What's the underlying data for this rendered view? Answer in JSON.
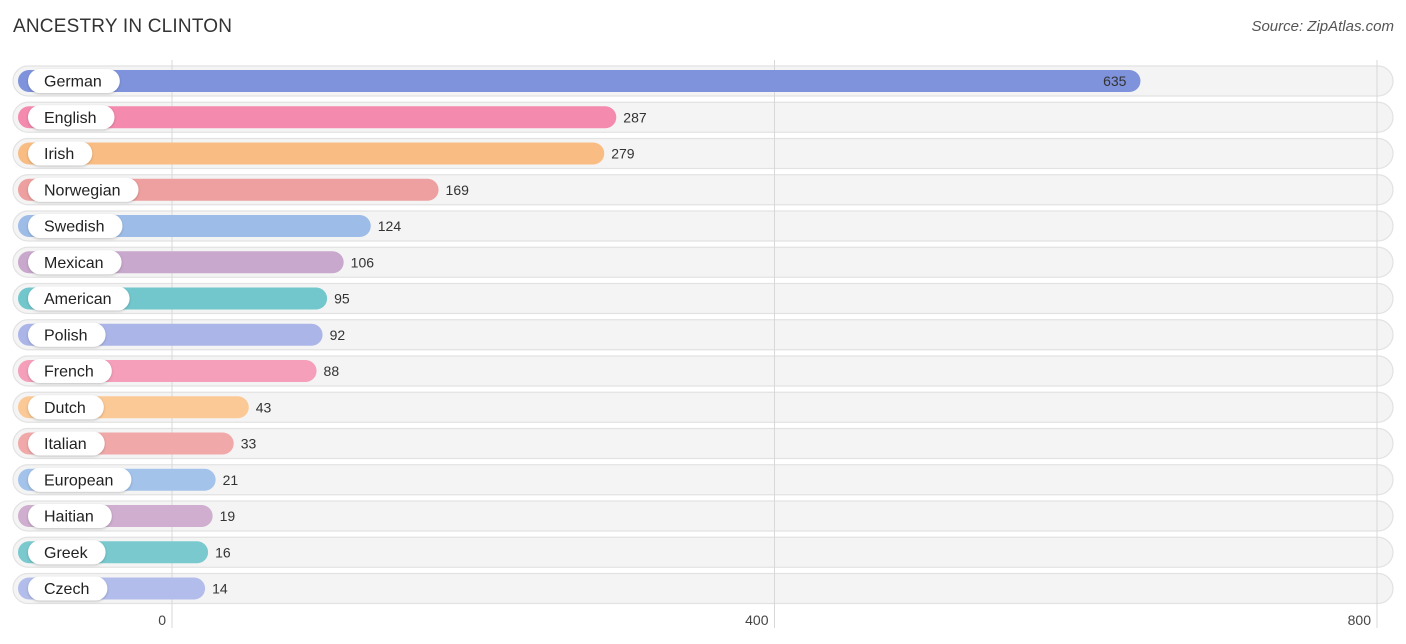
{
  "header": {
    "title": "ANCESTRY IN CLINTON",
    "source": "Source: ZipAtlas.com"
  },
  "chart_data": {
    "type": "bar",
    "orientation": "horizontal",
    "title": "ANCESTRY IN CLINTON",
    "xlabel": "",
    "ylabel": "",
    "xlim": [
      0,
      800
    ],
    "xticks": [
      0,
      400,
      800
    ],
    "grid": true,
    "categories": [
      "German",
      "English",
      "Irish",
      "Norwegian",
      "Swedish",
      "Mexican",
      "American",
      "Polish",
      "French",
      "Dutch",
      "Italian",
      "European",
      "Haitian",
      "Greek",
      "Czech"
    ],
    "values": [
      635,
      287,
      279,
      169,
      124,
      106,
      95,
      92,
      88,
      43,
      33,
      21,
      19,
      16,
      14
    ],
    "colors": [
      "#7f93dc",
      "#f48aad",
      "#f9bd84",
      "#eda09f",
      "#9dbde8",
      "#c8a8cc",
      "#72c7cc",
      "#abb5e8",
      "#f59fba",
      "#fbc995",
      "#f0a9a8",
      "#a3c3ea",
      "#cfaed0",
      "#79c9cf",
      "#b3bdeb"
    ]
  }
}
